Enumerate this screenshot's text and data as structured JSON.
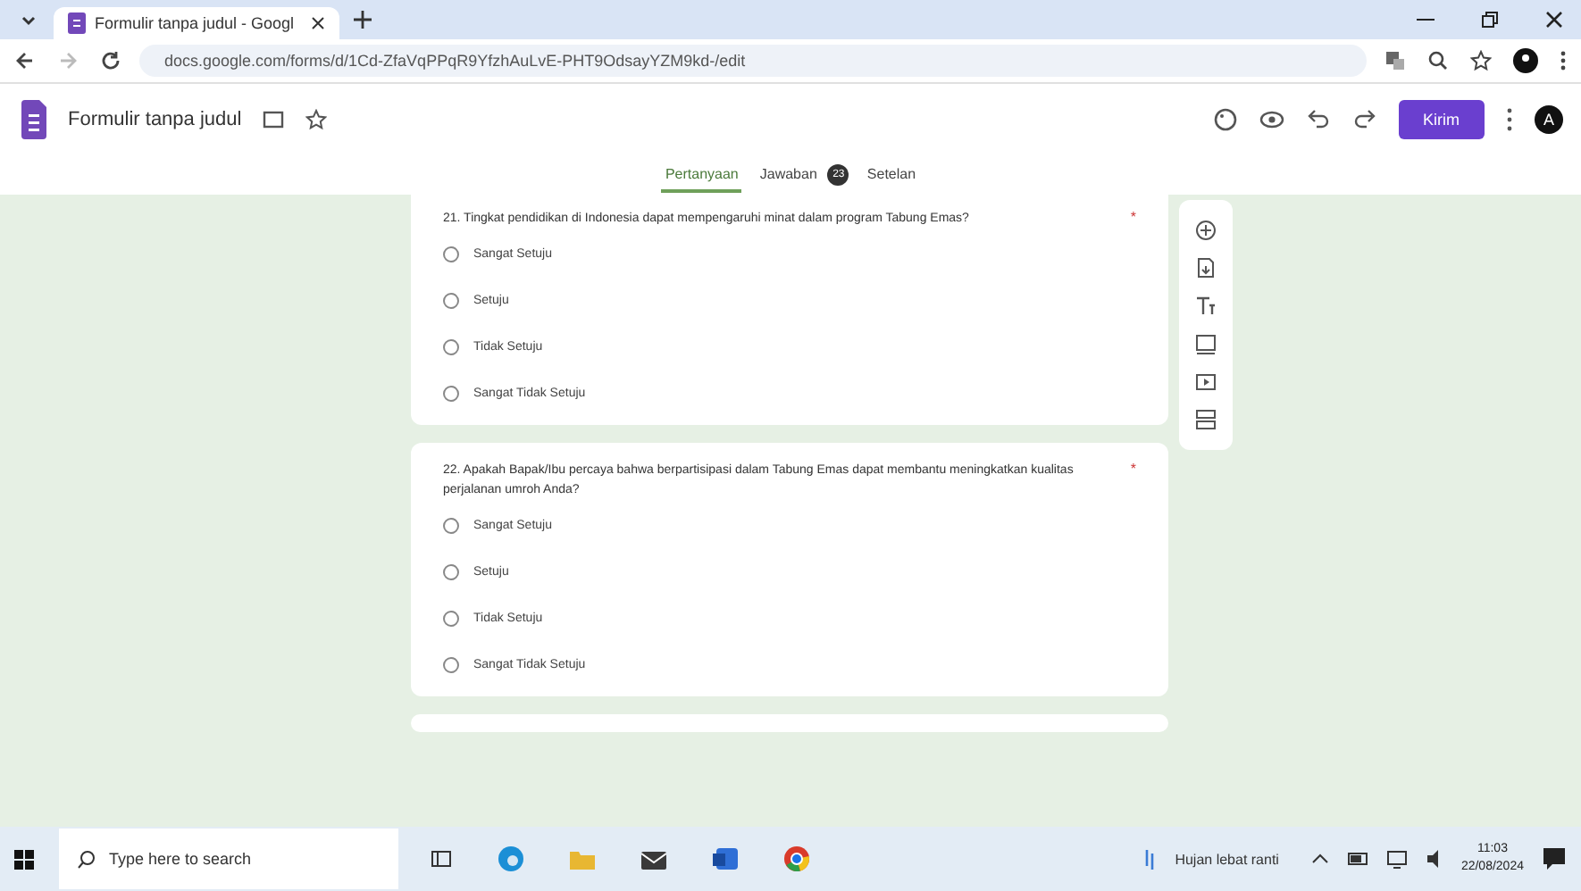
{
  "browser": {
    "tabs": [
      {
        "title": "Formulir tanpa judul - Googl",
        "selected": true
      }
    ],
    "url": "docs.google.com/forms/d/1Cd-ZfaVqPPqR9YfzhAuLvE-PHT9OdsayYZM9kd-/edit"
  },
  "form": {
    "title": "Formulir tanpa judul",
    "send_button": "Kirim",
    "avatar": "A",
    "tabs": [
      {
        "label": "Pertanyaan",
        "selected": true
      },
      {
        "label": "Jawaban",
        "selected": false,
        "badge": "23"
      },
      {
        "label": "Setelan",
        "selected": false
      }
    ],
    "questions": [
      {
        "text": "21. Tingkat pendidikan di Indonesia dapat mempengaruhi minat dalam program Tabung Emas?",
        "required_mark": "*",
        "options": [
          {
            "label": "Sangat Setuju",
            "selected": false
          },
          {
            "label": "Setuju",
            "selected": false
          },
          {
            "label": "Tidak Setuju",
            "selected": false
          },
          {
            "label": "Sangat Tidak Setuju",
            "selected": false
          }
        ]
      },
      {
        "text": "22. Apakah Bapak/Ibu percaya bahwa berpartisipasi dalam Tabung Emas dapat membantu meningkatkan kualitas perjalanan umroh Anda?",
        "required_mark": "*",
        "options": [
          {
            "label": "Sangat Setuju",
            "selected": false
          },
          {
            "label": "Setuju",
            "selected": false
          },
          {
            "label": "Tidak Setuju",
            "selected": false
          },
          {
            "label": "Sangat Tidak Setuju",
            "selected": false
          }
        ]
      }
    ]
  },
  "taskbar": {
    "search_placeholder": "Type here to search",
    "weather": "Hujan lebat ranti",
    "time": "11:03",
    "date": "22/08/2024"
  }
}
